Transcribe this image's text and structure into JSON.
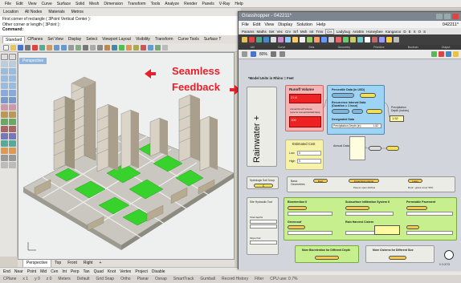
{
  "rhino": {
    "menu": [
      "File",
      "Edit",
      "View",
      "Curve",
      "Surface",
      "Solid",
      "Mesh",
      "Dimension",
      "Transform",
      "Tools",
      "Analyze",
      "Render",
      "Panels",
      "V-Ray",
      "Help"
    ],
    "toolbar": [
      "Location",
      "All Nodes",
      "Materials",
      "Metros"
    ],
    "command_history": [
      "First corner of rectangle ( 3Point  Vertical  Center ):",
      "Other corner or length ( 3Point ):"
    ],
    "command_label": "Command:",
    "tabs": [
      "Standard",
      "CPlanes",
      "Set View",
      "Display",
      "Select",
      "Viewport Layout",
      "Visibility",
      "Transform",
      "Curve Tools",
      "Surface T"
    ],
    "viewport_label": "Perspective",
    "bottom_tabs": [
      "Perspective",
      "Top",
      "Front",
      "Right",
      "+"
    ],
    "osnaps": [
      "End",
      "Near",
      "Point",
      "Mid",
      "Cen",
      "Int",
      "Perp",
      "Tan",
      "Quad",
      "Knot",
      "Vertex",
      "Project",
      "Disable"
    ],
    "status": [
      "CPlane",
      "x 1",
      "y 0",
      "z 0",
      "Meters",
      "Default",
      "Grid Snap",
      "Ortho",
      "Planar",
      "Osnap",
      "SmartTrack",
      "Gumball",
      "Record History",
      "Filter",
      "CPU use: 0.7%"
    ],
    "callout_line1": "Seamless",
    "callout_line2": "Feedback"
  },
  "gh": {
    "title": "Grasshopper - 042211*",
    "menu": [
      "File",
      "Edit",
      "View",
      "Display",
      "Solution",
      "Help"
    ],
    "file_label": "042211*",
    "ribbon_tabs": [
      "Params",
      "Maths",
      "Set",
      "Vec",
      "Crv",
      "Srf",
      "Msh",
      "Int",
      "Trns",
      "Dis",
      "Ladybug",
      "Ant4tm",
      "Honeybee",
      "Kangaroo",
      "D",
      "E",
      "X",
      "O",
      "S"
    ],
    "ribbon_categories": [
      "Util",
      "Curve",
      "Sets",
      "Geometry",
      "Primitive",
      "Boolean",
      "Output"
    ],
    "zoom": "80%",
    "canvas_title": "*Model Units in Rhino = Feet",
    "big_label": "Rainwater +",
    "runoff_title": "Runoff Volume",
    "runoff_values": [
      "21.6",
      "100"
    ],
    "runoff_note": "Annual Runoff Volume\n(note for Annual Rainfall Data)",
    "percentile_title": "Percentile Data (in USD)",
    "recurrence_title": "Recurrence Interval Data\n(Duration = 1 hour)",
    "designated_title": "Designated Data",
    "designated_value": "Precipitation Depth (in)",
    "designated_num": "1.52",
    "precip_label": "Precipitation\nDepth (inches)",
    "precip_value": "1.52",
    "annual_label": "Annual Data",
    "estimated_title": "Estimated Cost",
    "low_label": "Low",
    "high_label": "High",
    "low_value": "0",
    "high_value": "0",
    "hydrologic_label": "Hydrologic Soil Group",
    "hydrologic_value": "C",
    "basic_label": "Basic\nGeometries",
    "basic_items": [
      "Roof",
      "Impervious paving",
      "Lawn"
    ],
    "basic_items2": [
      "Paved, open ditches",
      "Roof - grass cover 50%"
    ],
    "site_label": "Site Hydraulic Tool",
    "site_sub": [
      "Total depths",
      "Slope find"
    ],
    "bio_title": "Bioretention II",
    "subsurface_title": "Subsurface Infiltration System II",
    "permeable_title": "Permeable Pavement",
    "greenroof_title": "Greenroof",
    "rainbarrel_title": "Rain Harvest Cistern",
    "bottom1": "More Bioretention for Different Depth",
    "bottom2": "More Cisterns for Different Size",
    "footer": "0.0.0078"
  }
}
